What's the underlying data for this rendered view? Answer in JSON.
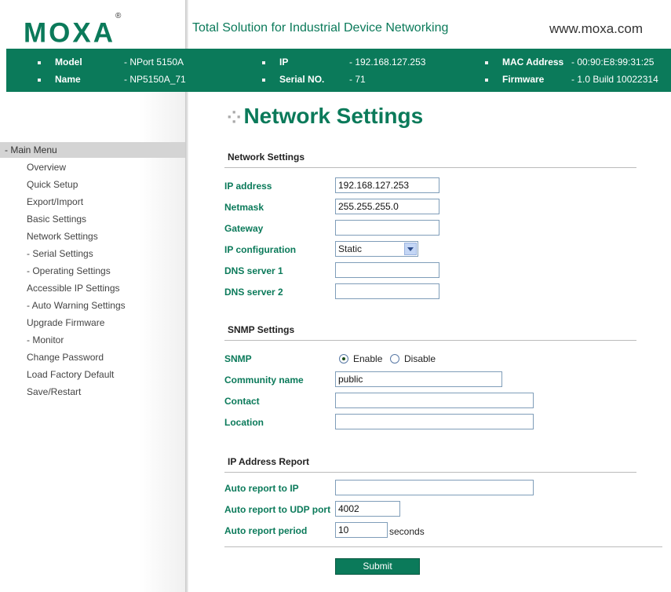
{
  "header": {
    "logo": "MOXA",
    "registered": "®",
    "tagline": "Total Solution for Industrial Device Networking",
    "website": "www.moxa.com"
  },
  "info": {
    "model_label": "Model",
    "model_value": "- NPort 5150A",
    "name_label": "Name",
    "name_value": "- NP5150A_71",
    "ip_label": "IP",
    "ip_value": "- 192.168.127.253",
    "serial_label": "Serial NO.",
    "serial_value": "- 71",
    "mac_label": "MAC Address",
    "mac_value": "- 00:90:E8:99:31:25",
    "firmware_label": "Firmware",
    "firmware_value": "- 1.0 Build 10022314"
  },
  "menu": {
    "header": "- Main Menu",
    "items": [
      "Overview",
      "Quick Setup",
      "Export/Import",
      "Basic Settings",
      "Network Settings",
      "- Serial Settings",
      "- Operating Settings",
      "Accessible IP Settings",
      "- Auto Warning Settings",
      "Upgrade Firmware",
      "- Monitor",
      "Change Password",
      "Load Factory Default",
      "Save/Restart"
    ]
  },
  "page": {
    "title": "Network Settings",
    "network_section": "Network Settings",
    "ip_address_label": "IP address",
    "ip_address_value": "192.168.127.253",
    "netmask_label": "Netmask",
    "netmask_value": "255.255.255.0",
    "gateway_label": "Gateway",
    "gateway_value": "",
    "ipconfig_label": "IP configuration",
    "ipconfig_value": "Static",
    "dns1_label": "DNS server 1",
    "dns1_value": "",
    "dns2_label": "DNS server 2",
    "dns2_value": "",
    "snmp_section": "SNMP Settings",
    "snmp_label": "SNMP",
    "snmp_enable": "Enable",
    "snmp_disable": "Disable",
    "community_label": "Community name",
    "community_value": "public",
    "contact_label": "Contact",
    "contact_value": "",
    "location_label": "Location",
    "location_value": "",
    "report_section": "IP Address Report",
    "auto_ip_label": "Auto report to IP",
    "auto_ip_value": "",
    "auto_udp_label": "Auto report to UDP port",
    "auto_udp_value": "4002",
    "auto_period_label": "Auto report period",
    "auto_period_value": "10",
    "seconds": "seconds",
    "submit": "Submit"
  },
  "colors": {
    "brand": "#0b7a5a"
  }
}
